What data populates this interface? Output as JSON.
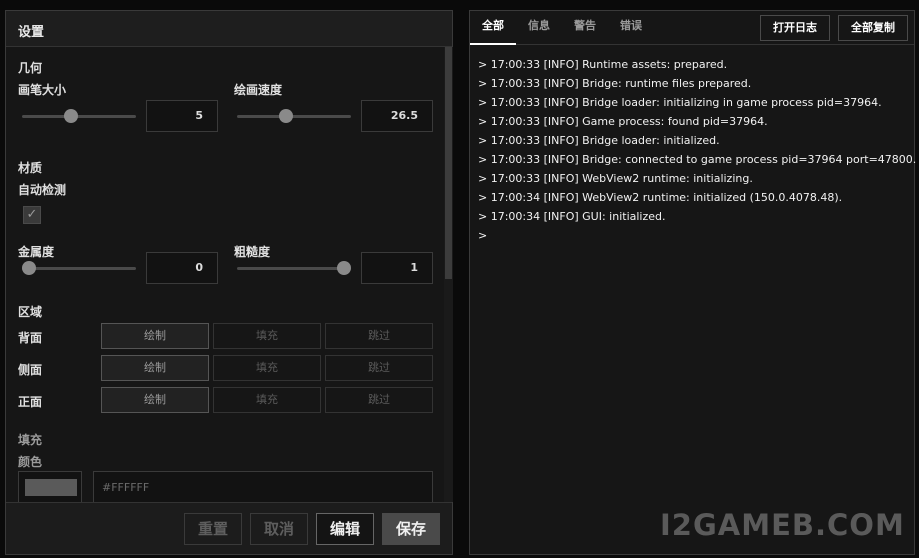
{
  "settings": {
    "title": "设置",
    "geometry": {
      "section_label": "几何",
      "brush_size": {
        "label": "画笔大小",
        "value": "5",
        "fraction": 0.42
      },
      "draw_speed": {
        "label": "绘画速度",
        "value": "26.5",
        "fraction": 0.42
      }
    },
    "material": {
      "section_label": "材质",
      "auto_detect_label": "自动检测",
      "auto_detect_checked": true,
      "metalness": {
        "label": "金属度",
        "value": "0",
        "fraction": 0.0
      },
      "roughness": {
        "label": "粗糙度",
        "value": "1",
        "fraction": 1.0
      }
    },
    "region": {
      "section_label": "区域",
      "rows": [
        {
          "label": "背面",
          "options": [
            "绘制",
            "填充",
            "跳过"
          ],
          "selected": 0
        },
        {
          "label": "侧面",
          "options": [
            "绘制",
            "填充",
            "跳过"
          ],
          "selected": 0
        },
        {
          "label": "正面",
          "options": [
            "绘制",
            "填充",
            "跳过"
          ],
          "selected": 0
        }
      ]
    },
    "fill": {
      "section_label": "填充",
      "color_label": "颜色",
      "color_hex": "#FFFFFF",
      "swatch_color": "#5a5a5a"
    },
    "footer": {
      "reset_label": "重置",
      "cancel_label": "取消",
      "edit_label": "编辑",
      "save_label": "保存"
    }
  },
  "console": {
    "tabs": [
      "全部",
      "信息",
      "警告",
      "错误"
    ],
    "active_tab": 0,
    "open_log_label": "打开日志",
    "copy_all_label": "全部复制",
    "lines": [
      "> 17:00:33 [INFO] Runtime assets: prepared.",
      "> 17:00:33 [INFO] Bridge: runtime files prepared.",
      "> 17:00:33 [INFO] Bridge loader: initializing in game process pid=37964.",
      "> 17:00:33 [INFO] Game process: found pid=37964.",
      "> 17:00:33 [INFO] Bridge loader: initialized.",
      "> 17:00:33 [INFO] Bridge: connected to game process pid=37964 port=47800.",
      "> 17:00:33 [INFO] WebView2 runtime: initializing.",
      "> 17:00:34 [INFO] WebView2 runtime: initialized (150.0.4078.48).",
      "> 17:00:34 [INFO] GUI: initialized.",
      ">"
    ]
  },
  "watermark": "I2GAMEB.COM"
}
